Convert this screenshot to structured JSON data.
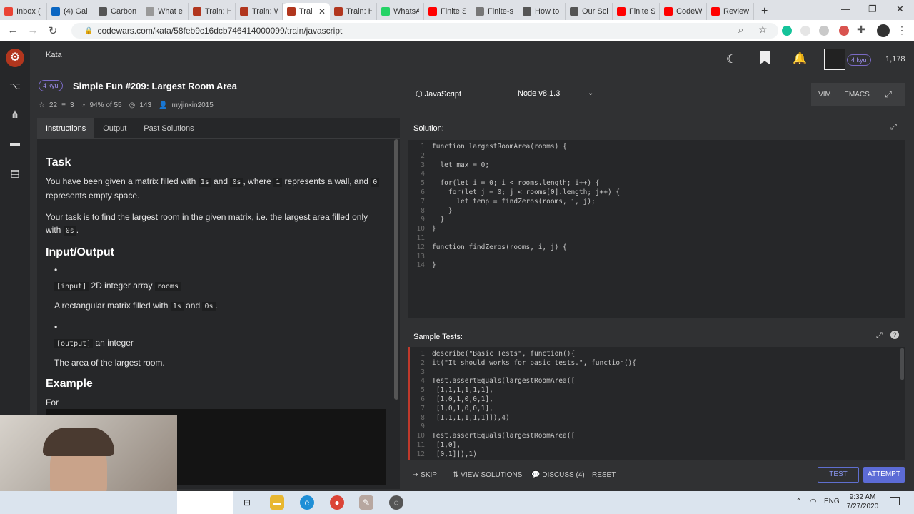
{
  "browser": {
    "tabs": [
      {
        "label": "Inbox (",
        "color": "#ea4335"
      },
      {
        "label": "(4) Gal",
        "color": "#0a66c2"
      },
      {
        "label": "Carbon",
        "color": "#555555"
      },
      {
        "label": "What e",
        "color": "#999999"
      },
      {
        "label": "Train: H",
        "color": "#b1361e"
      },
      {
        "label": "Train: W",
        "color": "#b1361e"
      },
      {
        "label": "Trai",
        "color": "#b1361e",
        "active": true
      },
      {
        "label": "Train: H",
        "color": "#b1361e"
      },
      {
        "label": "WhatsA",
        "color": "#25d366"
      },
      {
        "label": "Finite S",
        "color": "#ff0000"
      },
      {
        "label": "Finite-s",
        "color": "#777777"
      },
      {
        "label": "How to",
        "color": "#555555"
      },
      {
        "label": "Our Sch",
        "color": "#555555"
      },
      {
        "label": "Finite S",
        "color": "#ff0000"
      },
      {
        "label": "CodeW",
        "color": "#ff0000"
      },
      {
        "label": "Review",
        "color": "#ff0000"
      }
    ],
    "new_tab": "+",
    "url": "codewars.com/kata/58feb9c16dcb746414000099/train/javascript"
  },
  "app": {
    "topbar": {
      "section": "Kata",
      "rank": "4 kyu",
      "honor": "1,178"
    },
    "kata": {
      "rank": "4 kyu",
      "title": "Simple Fun #209: Largest Room Area",
      "stars": "22",
      "collections": "3",
      "satisfaction": "94% of 55",
      "completed": "143",
      "author": "myjinxin2015"
    },
    "left_tabs": [
      "Instructions",
      "Output",
      "Past Solutions"
    ],
    "instructions": {
      "task_heading": "Task",
      "p1": [
        "You have been given a matrix filled with ",
        "1s",
        " and ",
        "0s",
        ", where ",
        "1",
        " represents a wall, and ",
        "0",
        " represents empty space."
      ],
      "p2": [
        "Your task is to find the largest room in the given matrix, i.e. the largest area filled only with ",
        "0s",
        "."
      ],
      "io_heading": "Input/Output",
      "input_tag": "[input]",
      "input_type": " 2D integer array ",
      "input_name": "rooms",
      "input_desc": [
        "A rectangular matrix filled with ",
        "1s",
        " and ",
        "0s",
        "."
      ],
      "output_tag": "[output]",
      "output_type": " an integer",
      "output_desc": "The area of the largest room.",
      "example_heading": "Example",
      "for_text": "For"
    },
    "language": "JavaScript",
    "version": "Node v8.1.3",
    "editor_modes": [
      "VIM",
      "EMACS"
    ],
    "solution_label": "Solution:",
    "solution_lines": [
      "function largestRoomArea(rooms) {",
      "",
      "  let max = 0;",
      "",
      "  for(let i = 0; i < rooms.length; i++) {",
      "    for(let j = 0; j < rooms[0].length; j++) {",
      "      let temp = findZeros(rooms, i, j);",
      "    }",
      "  }",
      "}",
      "",
      "function findZeros(rooms, i, j) {",
      "",
      "}"
    ],
    "tests_label": "Sample Tests:",
    "test_lines": [
      {
        "n": "1",
        "t": "describe(\"Basic Tests\", function(){"
      },
      {
        "n": "2",
        "t": "it(\"It should works for basic tests.\", function(){"
      },
      {
        "n": "3",
        "t": ""
      },
      {
        "n": "4",
        "t": "Test.assertEquals(largestRoomArea(["
      },
      {
        "n": "5",
        "t": " [1,1,1,1,1,1],"
      },
      {
        "n": "6",
        "t": " [1,0,1,0,0,1],"
      },
      {
        "n": "7",
        "t": " [1,0,1,0,0,1],"
      },
      {
        "n": "8",
        "t": " [1,1,1,1,1,1]]),4)"
      },
      {
        "n": "9",
        "t": ""
      },
      {
        "n": "10",
        "t": "Test.assertEquals(largestRoomArea(["
      },
      {
        "n": "11",
        "t": " [1,0],"
      },
      {
        "n": "12",
        "t": " [0,1]]),1)"
      }
    ],
    "bottom": {
      "skip": "SKIP",
      "view_solutions": "VIEW SOLUTIONS",
      "discuss": "DISCUSS (4)",
      "reset": "RESET",
      "test": "TEST",
      "attempt": "ATTEMPT"
    }
  },
  "taskbar": {
    "lang": "ENG",
    "time": "9:32 AM",
    "date": "7/27/2020"
  }
}
